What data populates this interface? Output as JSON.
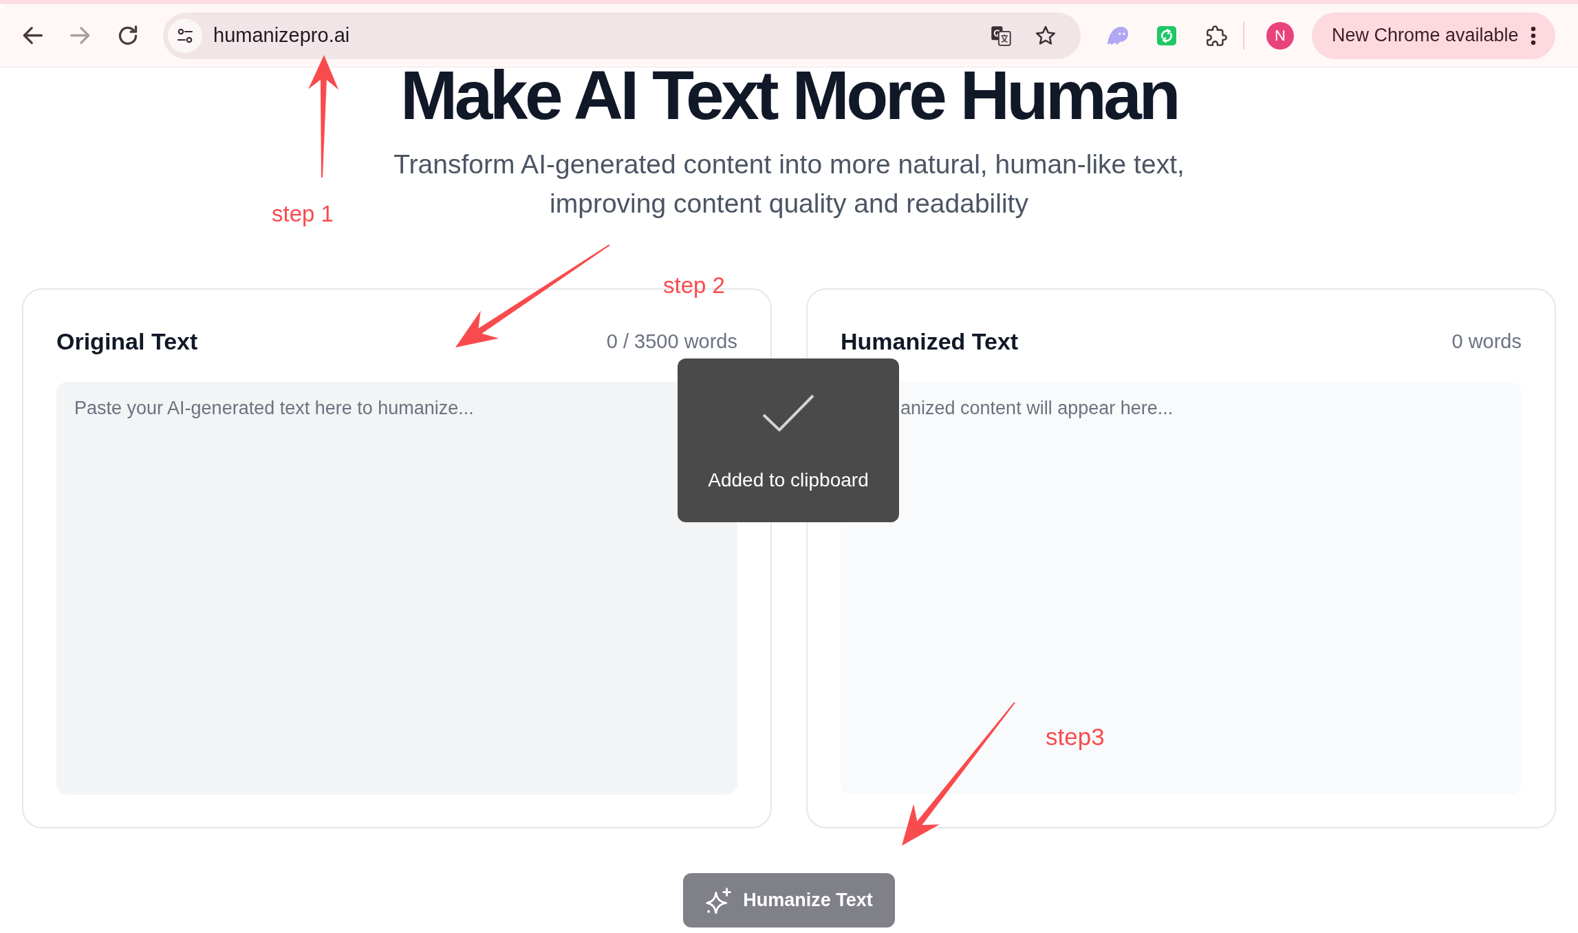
{
  "browser": {
    "nav_buttons": [
      {
        "kind": "back",
        "disabled": false
      },
      {
        "kind": "forward",
        "disabled": true
      },
      {
        "kind": "reload",
        "disabled": false
      }
    ],
    "address_bar": {
      "url": "humanizepro.ai"
    },
    "profile": {
      "initial": "N"
    },
    "update_button": {
      "label": "New Chrome available"
    }
  },
  "hero": {
    "title": "Make AI Text More Human",
    "subtitle": "Transform AI-generated content into more natural, human-like text, improving content quality and readability"
  },
  "panels": [
    {
      "kind": "input",
      "title": "Original Text",
      "count": "0 / 3500 words",
      "placeholder": "Paste your AI-generated text here to humanize..."
    },
    {
      "kind": "output",
      "title": "Humanized Text",
      "count": "0 words",
      "placeholder": "anized content will appear here..."
    }
  ],
  "toast": {
    "message": "Added to clipboard"
  },
  "humanize_button": {
    "label": "Humanize Text",
    "disabled": true
  },
  "annotations": [
    {
      "label": "step 1"
    },
    {
      "label": "step 2"
    },
    {
      "label": "step3"
    }
  ]
}
